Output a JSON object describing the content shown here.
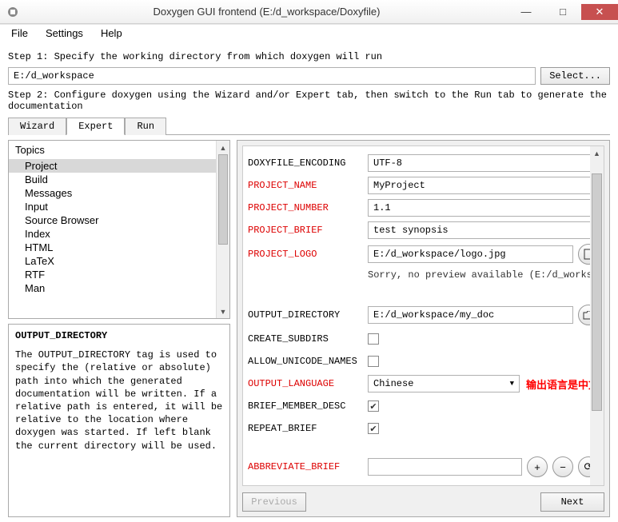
{
  "window": {
    "title": "Doxygen GUI frontend (E:/d_workspace/Doxyfile)"
  },
  "winbtns": {
    "min": "—",
    "max": "□",
    "close": "✕"
  },
  "menu": {
    "file": "File",
    "settings": "Settings",
    "help": "Help"
  },
  "step1_label": "Step 1: Specify the working directory from which doxygen will run",
  "workdir": "E:/d_workspace",
  "select_btn": "Select...",
  "step2_label": "Step 2: Configure doxygen using the Wizard and/or Expert tab, then switch to the Run tab to generate the documentation",
  "tabs": {
    "wizard": "Wizard",
    "expert": "Expert",
    "run": "Run"
  },
  "topics": {
    "header": "Topics",
    "items": [
      "Project",
      "Build",
      "Messages",
      "Input",
      "Source Browser",
      "Index",
      "HTML",
      "LaTeX",
      "RTF",
      "Man"
    ]
  },
  "help": {
    "title": "OUTPUT_DIRECTORY",
    "body": "The OUTPUT_DIRECTORY tag is used to specify the (relative or absolute) path into which the generated documentation will be written. If a relative path is entered, it will be relative to the location where doxygen was started. If left blank the current directory will be used."
  },
  "form": {
    "doxyfile_encoding": {
      "label": "DOXYFILE_ENCODING",
      "value": "UTF-8"
    },
    "project_name": {
      "label": "PROJECT_NAME",
      "value": "MyProject"
    },
    "project_number": {
      "label": "PROJECT_NUMBER",
      "value": "1.1"
    },
    "project_brief": {
      "label": "PROJECT_BRIEF",
      "value": "test synopsis"
    },
    "project_logo": {
      "label": "PROJECT_LOGO",
      "value": "E:/d_workspace/logo.jpg"
    },
    "logo_note": "Sorry, no preview available (E:/d_works",
    "output_directory": {
      "label": "OUTPUT_DIRECTORY",
      "value": "E:/d_workspace/my_doc"
    },
    "create_subdirs": {
      "label": "CREATE_SUBDIRS",
      "checked": false
    },
    "allow_unicode_names": {
      "label": "ALLOW_UNICODE_NAMES",
      "checked": false
    },
    "output_language": {
      "label": "OUTPUT_LANGUAGE",
      "value": "Chinese",
      "annotation": "输出语言是中文"
    },
    "brief_member_desc": {
      "label": "BRIEF_MEMBER_DESC",
      "checked": true
    },
    "repeat_brief": {
      "label": "REPEAT_BRIEF",
      "checked": true
    },
    "abbreviate_brief": {
      "label": "ABBREVIATE_BRIEF",
      "value": ""
    }
  },
  "nav": {
    "prev": "Previous",
    "next": "Next"
  }
}
